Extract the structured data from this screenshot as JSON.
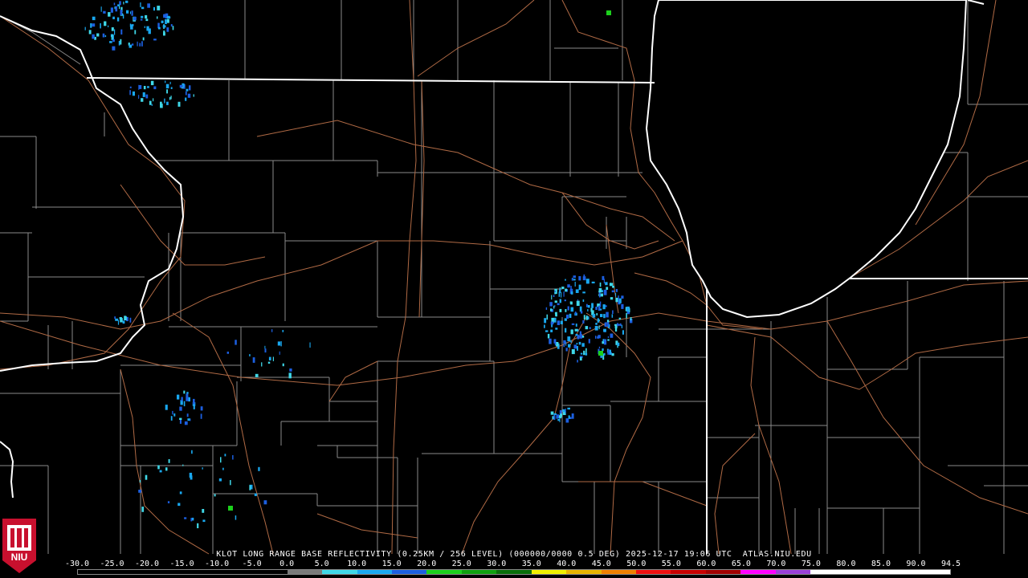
{
  "caption": {
    "radar_site": "KLOT",
    "product": "LONG RANGE BASE REFLECTIVITY",
    "resolution": "(0.25KM / 256 LEVEL)",
    "volume": "(000000/0000",
    "tilt": "0.5 DEG)",
    "date": "2025-12-17",
    "time": "19:06 UTC",
    "source": "ATLAS.NIU.EDU"
  },
  "legend": {
    "labels": [
      "-30.0",
      "-25.0",
      "-20.0",
      "-15.0",
      "-10.0",
      "-5.0",
      "0.0",
      "5.0",
      "10.0",
      "15.0",
      "20.0",
      "25.0",
      "30.0",
      "35.0",
      "40.0",
      "45.0",
      "50.0",
      "55.0",
      "60.0",
      "65.0",
      "70.0",
      "75.0",
      "80.0",
      "85.0",
      "90.0",
      "94.5"
    ],
    "colors": [
      "#000000",
      "#000000",
      "#000000",
      "#000000",
      "#000000",
      "#000000",
      "#7a7a7a",
      "#3fd8e8",
      "#19a8f0",
      "#1c5fe0",
      "#1cd01c",
      "#10a010",
      "#0a6e0a",
      "#f0f000",
      "#e8b400",
      "#f08000",
      "#f01010",
      "#c80000",
      "#a00000",
      "#ff00ff",
      "#9a40d8",
      "#ffffff",
      "#ffffff",
      "#ffffff",
      "#ffffff"
    ]
  },
  "logo": {
    "text": "NIU",
    "color": "#c8102e"
  },
  "map": {
    "state_border_color": "#ffffff",
    "county_color": "#8a8a8a",
    "road_color": "#b06a45",
    "echo_colors": [
      "#19a8f0",
      "#3fd8e8",
      "#1c5fe0",
      "#1cd01c"
    ]
  }
}
